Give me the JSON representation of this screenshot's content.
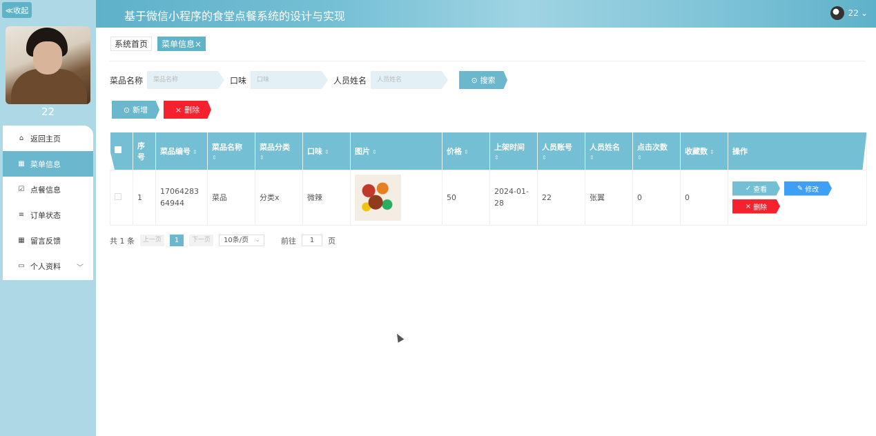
{
  "sidebar": {
    "collapse_label": "≪收起",
    "username": "22",
    "items": [
      {
        "label": "返回主页",
        "icon": "home-icon",
        "glyph": "⌂",
        "active": false
      },
      {
        "label": "菜单信息",
        "icon": "grid-icon",
        "glyph": "▦",
        "active": true
      },
      {
        "label": "点餐信息",
        "icon": "checkbox-icon",
        "glyph": "☑",
        "active": false
      },
      {
        "label": "订单状态",
        "icon": "list-icon",
        "glyph": "≡",
        "active": false
      },
      {
        "label": "留言反馈",
        "icon": "grid-icon",
        "glyph": "▦",
        "active": false
      },
      {
        "label": "个人资料",
        "icon": "card-icon",
        "glyph": "▭",
        "active": false,
        "chevron": "﹀"
      }
    ]
  },
  "header": {
    "title": "基于微信小程序的食堂点餐系统的设计与实现",
    "user": "22",
    "dropdown_glyph": "⌄"
  },
  "breadcrumb": {
    "home": "系统首页",
    "current": "菜单信息",
    "close_glyph": "×"
  },
  "search": {
    "name_label": "菜品名称",
    "name_placeholder": "菜品名称",
    "taste_label": "口味",
    "taste_placeholder": "口味",
    "person_label": "人员姓名",
    "person_placeholder": "人员姓名",
    "button_label": "搜索",
    "button_icon": "⊙"
  },
  "actions": {
    "add_label": "新增",
    "add_icon": "⊙",
    "delete_label": "删除",
    "delete_icon": "×"
  },
  "table": {
    "headers": [
      "序号",
      "菜品编号",
      "菜品名称",
      "菜品分类",
      "口味",
      "图片",
      "价格",
      "上架时间",
      "人员账号",
      "人员姓名",
      "点击次数",
      "收藏数",
      "操作"
    ],
    "sort_glyph": "⇕",
    "rows": [
      {
        "index": "1",
        "code": "1706428364944",
        "name": "菜品",
        "category": "分类x",
        "taste": "微辣",
        "price": "50",
        "date": "2024-01-28",
        "account": "22",
        "person": "张翼",
        "clicks": "0",
        "favorites": "0"
      }
    ],
    "ops": {
      "view": "查看",
      "view_icon": "✓",
      "edit": "修改",
      "edit_icon": "✎",
      "delete": "删除",
      "delete_icon": "×"
    }
  },
  "pagination": {
    "total": "共 1 条",
    "prev": "上一页",
    "page": "1",
    "next": "下一页",
    "page_size": "10条/页",
    "dropdown_glyph": "⌄",
    "goto_label": "前往",
    "goto_value": "1",
    "page_suffix": "页"
  },
  "colors": {
    "primary": "#6bb7cd",
    "danger": "#f5222d",
    "edit": "#3f9ff5"
  }
}
